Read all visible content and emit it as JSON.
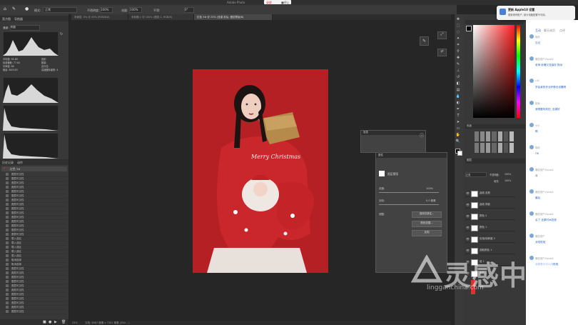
{
  "app": {
    "title": "Adobe Photo"
  },
  "recording": {
    "label_a": "录屏",
    "label_b": "■停止"
  },
  "options": {
    "mode": "正常",
    "opacity_label": "不透明度:",
    "opacity": "100%",
    "flow_label": "流量:",
    "flow": "100%",
    "smoothing_label": "平滑:",
    "angle": "0°"
  },
  "tabs": [
    {
      "label": "背景层, 0% @ 50% (RGB/8#)"
    },
    {
      "label": "未标题-1 @ 100% (图层 1, RGB/8)"
    },
    {
      "label": "红色 3# @ 25% (圣诞 前后, 图层蒙版/8)"
    }
  ],
  "left_panel": {
    "tabs": [
      "直方图",
      "导航器"
    ],
    "channel": "明度",
    "stats": [
      {
        "k": "平均值:",
        "v": "95.89"
      },
      {
        "k": "标准偏差:",
        "v": "77.64"
      },
      {
        "k": "中间值:",
        "v": "66"
      },
      {
        "k": "像素:",
        "v": "840163"
      },
      {
        "k": "色阶:",
        "v": ""
      },
      {
        "k": "数量:",
        "v": ""
      },
      {
        "k": "百分位:",
        "v": ""
      },
      {
        "k": "高速缓存级别:",
        "v": "4"
      }
    ],
    "actions_tabs": [
      "历史记录",
      "动作"
    ],
    "actions_folder": "红色 3#",
    "actions": [
      "图层可见性",
      "图层可见性",
      "图层可见性",
      "图层可见性",
      "图层可见性",
      "图层可见性",
      "图层可见性",
      "图层可见性",
      "图层可见性",
      "图层可见性",
      "图层可见性",
      "图层可见性",
      "图层可见性",
      "图层可见性",
      "图层可见性",
      "载入选区",
      "载入选区",
      "载入选区",
      "载入选区",
      "载入选区",
      "取消选择",
      "取消选择",
      "图层可见性",
      "图层可见性",
      "图层可见性",
      "图层可见性",
      "图层可见性",
      "图层可见性",
      "图层可见性",
      "图层可见性",
      "图层可见性",
      "图层可见性",
      "图层可见性"
    ]
  },
  "panels": {
    "properties_title": "属性",
    "mask_label": "图层蒙版",
    "density_label": "浓度:",
    "density": "100%",
    "feather_label": "羽化:",
    "feather": "0.0 像素",
    "refine_label": "调整:",
    "btn_select_mask": "选择并遮住...",
    "btn_color_range": "颜色范围...",
    "btn_invert": "反相",
    "small_panel_title": "信息"
  },
  "photo": {
    "sweater_text": "Merry Christmas"
  },
  "layers": {
    "header": "图层",
    "blend": "正常",
    "opacity_label": "不透明度:",
    "opacity": "100%",
    "fill_label": "填充:",
    "fill": "100%",
    "items": [
      "曲线 皮肤",
      "曲线 阴影",
      "颜色 2",
      "颜色 1",
      "色相/饱和度 2",
      "选取颜色 1",
      "组 1",
      "图层 1"
    ]
  },
  "swatches_title": "色板",
  "chat": {
    "tabs": [
      "互动",
      "聊天成员",
      "点评"
    ],
    "messages": [
      {
        "name": "晓晴",
        "text": "忘记"
      },
      {
        "name": "微信用户:Facial2",
        "text": "老师 卧槽又没保存 拖动"
      },
      {
        "name": "Lilli",
        "text": "学会我的作业好像也设置啊"
      },
      {
        "name": "彭雨",
        "text": "我想要特效的, 没调好"
      },
      {
        "name": "小小",
        "text": "啊"
      },
      {
        "name": "晓晴",
        "text": "OK"
      },
      {
        "name": "微信用户:Facial2",
        "text": "对"
      },
      {
        "name": "微信用户:Facial2",
        "text": "最后"
      },
      {
        "name": "微信用户:Facial2",
        "text": "买了 还原时间发现"
      },
      {
        "name": "微信用户",
        "text": "对啦啦啦"
      },
      {
        "name": "微信用户:Facial2",
        "text": "我看看你怎么的啦啦"
      }
    ]
  },
  "notification": {
    "title": "更新 Apple10 设置",
    "body": "更新现有账户, 部分电脑配置不可用。"
  },
  "watermark": {
    "text": "灵感中国",
    "url": "lingganchina.com"
  },
  "status": {
    "zoom": "25%",
    "doc": "文档: 4867 像素 x 7301 像素 (300 ...)"
  },
  "colors": {
    "accent": "#e03030",
    "photo_red": "#b42024",
    "chat_link": "#2a64c4"
  }
}
